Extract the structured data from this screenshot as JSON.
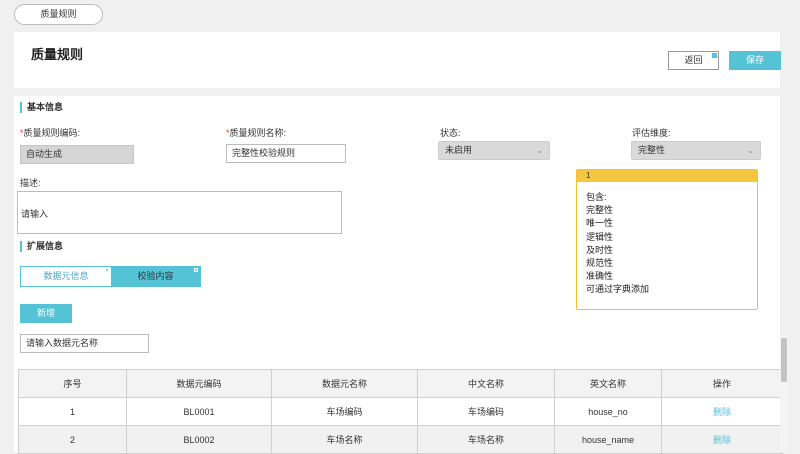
{
  "window_tab": {
    "label": "质量规则"
  },
  "header": {
    "title": "质量规则",
    "back_label": "返回",
    "save_label": "保存"
  },
  "basic_section": {
    "title": "基本信息"
  },
  "fields": {
    "code": {
      "required": "*",
      "label": "质量规则编码:",
      "value": "自动生成"
    },
    "name": {
      "required": "*",
      "label": "质量规则名称:",
      "value": "完整性校验规则"
    },
    "status": {
      "label": "状态:",
      "value": "未启用"
    },
    "dimension": {
      "label": "评估维度:",
      "value": "完整性"
    },
    "desc": {
      "label": "描述:",
      "placeholder": "请输入"
    }
  },
  "tooltip": {
    "header": "1",
    "lines": [
      "包含:",
      "完整性",
      "唯一性",
      "逻辑性",
      "及时性",
      "规范性",
      "准确性",
      "可通过字典添加"
    ]
  },
  "ext_section": {
    "title": "扩展信息"
  },
  "tabs": [
    {
      "label": "数据元信息"
    },
    {
      "label": "校验内容"
    }
  ],
  "add_button": {
    "label": "新增"
  },
  "filter": {
    "placeholder": "请输入数据元名称"
  },
  "table": {
    "columns": [
      "序号",
      "数据元编码",
      "数据元名称",
      "中文名称",
      "英文名称",
      "操作"
    ],
    "rows": [
      {
        "index": "1",
        "code": "BL0001",
        "name": "车场编码",
        "cn": "车场编码",
        "en": "house_no",
        "action": "删除"
      },
      {
        "index": "2",
        "code": "BL0002",
        "name": "车场名称",
        "cn": "车场名称",
        "en": "house_name",
        "action": "删除"
      }
    ]
  },
  "colors": {
    "accent": "#55c3d6",
    "required": "#e33333",
    "tooltip_border": "#f2c233",
    "tooltip_header": "#f5c63f"
  },
  "icons": {
    "select_arrow": "chevron-down-icon"
  }
}
